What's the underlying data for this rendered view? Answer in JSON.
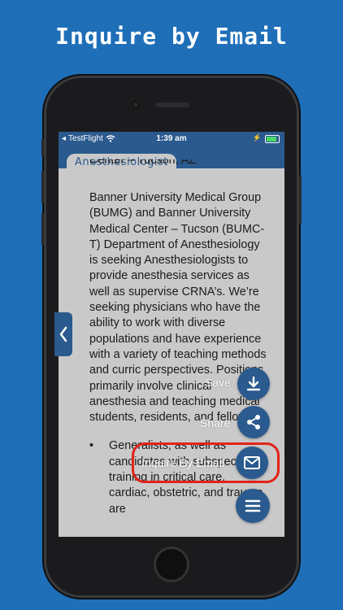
{
  "headline": "Inquire by Email",
  "status_bar": {
    "carrier": "TestFlight",
    "time": "1:39 am"
  },
  "app": {
    "title": "Anesthesiologist"
  },
  "content": {
    "cut_line": "Center – Tucson, AZ",
    "paragraph": "Banner University Medical Group (BUMG) and Banner University Medical Center – Tucson (BUMC-T) Department of Anesthesiology is seeking Anesthesiologists to provide anesthesia services as well as supervise CRNA’s. We’re seeking physicians who have the ability to work with diverse populations and have experience with a variety of teaching methods and curric perspectives. Positions primarily involve clinical anesthesia and teaching medical students, residents, and fellows.",
    "bullet": "Generalists, as well as candidates with subspecialty training in critical care, cardiac, obstetric, and trauma are"
  },
  "actions": {
    "save_label": "Save",
    "share_label": "Share",
    "email_label": "Inquire By Email"
  },
  "icons": {
    "back": "chevron-left-icon",
    "save": "download-icon",
    "share": "share-icon",
    "email": "mail-icon",
    "menu": "menu-icon"
  },
  "colors": {
    "background": "#1f6fb8",
    "app_blue": "#2a5a8e",
    "highlight": "#e2231a",
    "screen_overlay": "#c9c9c9"
  }
}
